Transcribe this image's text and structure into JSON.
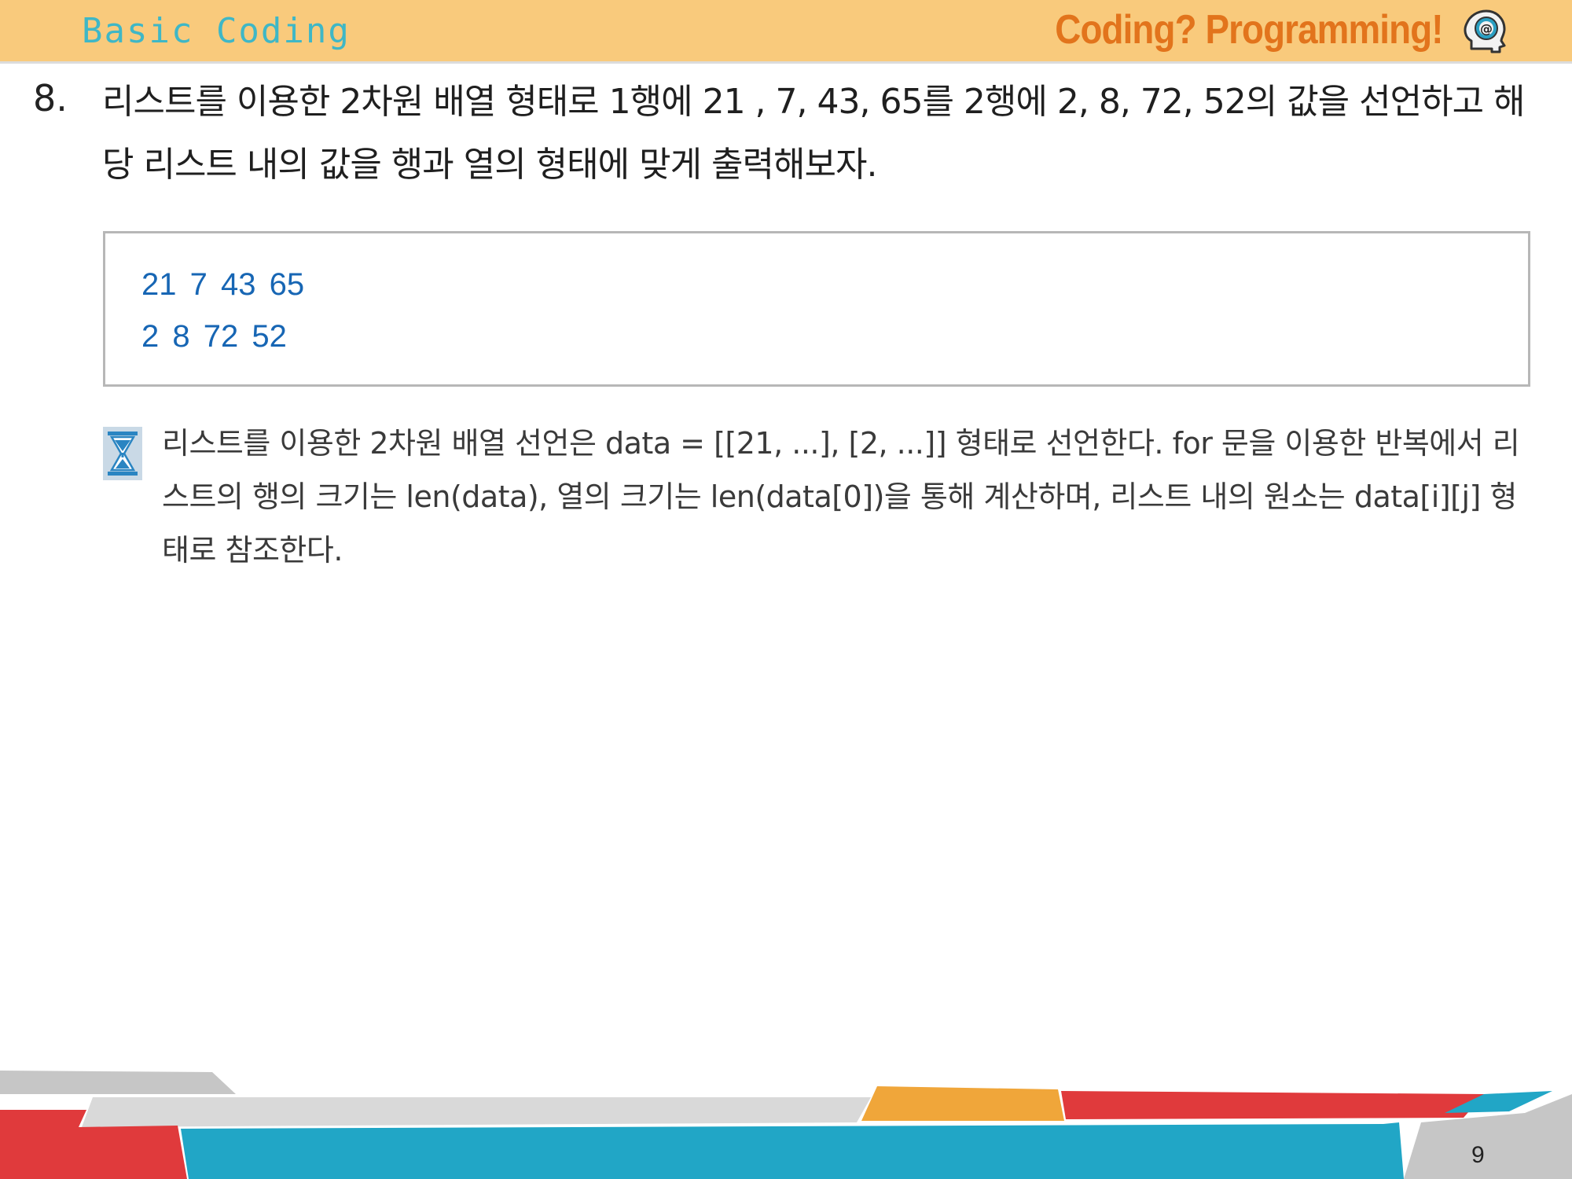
{
  "header": {
    "left_title": "Basic Coding",
    "brand": "Coding? Programming!",
    "brand_icon": "head-at-icon"
  },
  "question": {
    "number": "8.",
    "text": "리스트를 이용한 2차원 배열 형태로 1행에 21 , 7, 43, 65를 2행에 2, 8, 72, 52의 값을 선언하고 해당 리스트 내의 값을 행과 열의 형태에 맞게 출력해보자."
  },
  "output": {
    "lines": [
      "21  7  43  65",
      "2  8  72  52"
    ]
  },
  "hint": {
    "icon": "hourglass-icon",
    "text": "리스트를 이용한 2차원 배열 선언은 data = [[21, ...], [2, ...]] 형태로 선언한다. for 문을 이용한 반복에서 리스트의 행의 크기는 len(data), 열의 크기는 len(data[0])을 통해 계산하며, 리스트 내의 원소는 data[i][j] 형태로 참조한다."
  },
  "footer": {
    "page_number": "9"
  },
  "colors": {
    "header_bg": "#f9ca7c",
    "left_title": "#3fb7c6",
    "brand": "#e2741c",
    "output_text": "#1766b4",
    "footer_teal": "#21a6c6",
    "footer_red": "#e03a3c",
    "footer_orange": "#f0a63a",
    "footer_gray": "#d9d9d9"
  }
}
